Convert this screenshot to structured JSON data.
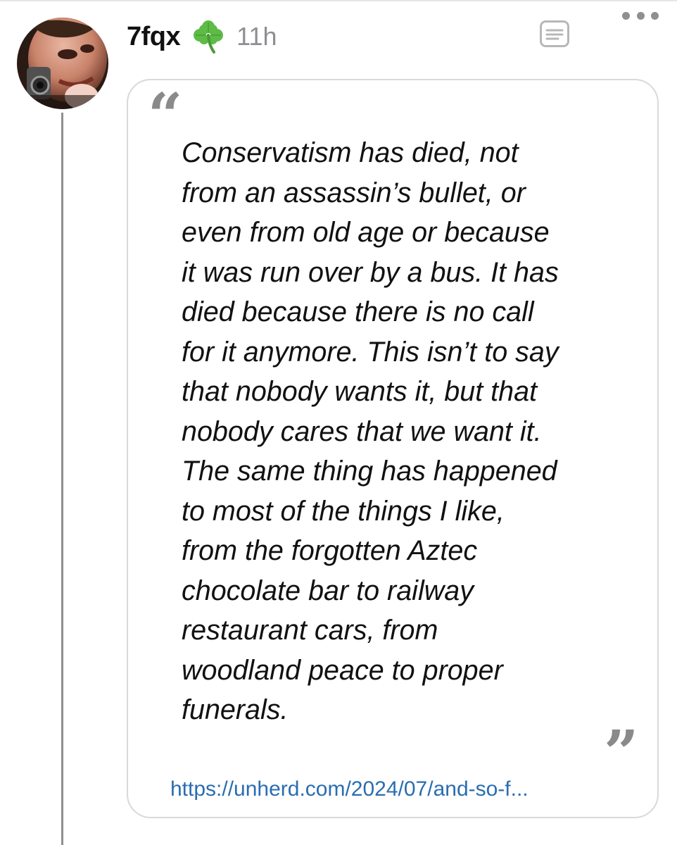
{
  "post": {
    "author": {
      "username": "7fqx",
      "flair_icon": "shamrock-icon",
      "avatar": "profile-avatar"
    },
    "time_ago": "11h",
    "quote": {
      "text": "Conservatism has died, not\nfrom an assassin’s bullet, or\neven from old age or because\nit was run over by a bus. It has\ndied because there is no call\nfor it anymore. This isn’t to say\nthat nobody wants it, but that\nnobody cares that we want it.\nThe same thing has happened\nto most of the things I like,\nfrom the forgotten Aztec\nchocolate bar to railway\nrestaurant cars, from\nwoodland peace to proper\nfunerals.",
      "open_mark": "“",
      "close_mark": "”",
      "link_text": "https://unherd.com/2024/07/and-so-f..."
    }
  },
  "colors": {
    "link": "#2a6db0",
    "muted": "#8e8e93",
    "card_border": "#d9d9d9",
    "clover": "#5dbb46"
  }
}
